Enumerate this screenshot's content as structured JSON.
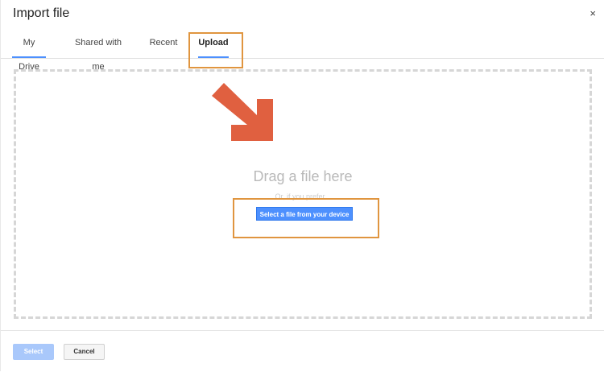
{
  "dialog": {
    "title": "Import file",
    "close_glyph": "×"
  },
  "tabs": [
    {
      "label": "My Drive",
      "active": false
    },
    {
      "label": "Shared with me",
      "active": false
    },
    {
      "label": "Recent",
      "active": false
    },
    {
      "label": "Upload",
      "active": true
    }
  ],
  "upload": {
    "drag_text": "Drag a file here",
    "prefer_text": "Or, if you prefer...",
    "select_device_label": "Select a file from your device",
    "arrow_icon": "arrow-down-right-icon"
  },
  "footer": {
    "select_label": "Select",
    "cancel_label": "Cancel"
  },
  "colors": {
    "accent": "#4d90fe",
    "highlight": "#e0953f",
    "arrow": "#e06040"
  }
}
